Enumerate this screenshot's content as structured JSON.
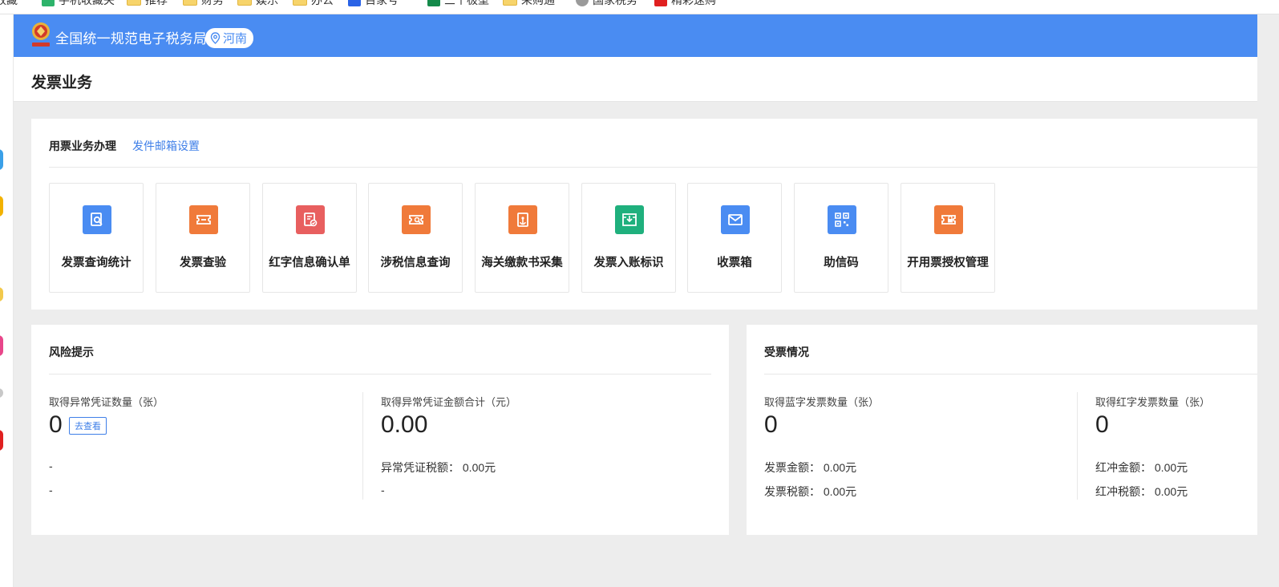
{
  "bookmarks": [
    {
      "label": "收藏",
      "icon": "none"
    },
    {
      "label": "手机收藏夹",
      "icon": "phone-bookmark-icon"
    },
    {
      "label": "推荐",
      "icon": "folder-icon"
    },
    {
      "label": "财务",
      "icon": "folder-icon"
    },
    {
      "label": "娱乐",
      "icon": "folder-icon"
    },
    {
      "label": "办公",
      "icon": "folder-icon"
    },
    {
      "label": "百家号",
      "icon": "baidu-icon"
    },
    {
      "label": "三个极型",
      "icon": "green-app-icon"
    },
    {
      "label": "采购通",
      "icon": "folder-icon"
    },
    {
      "label": "国家税务",
      "icon": "gear-icon"
    },
    {
      "label": "精彩速购",
      "icon": "red-app-icon"
    }
  ],
  "header": {
    "site_title": "全国统一规范电子税务局",
    "region": "河南",
    "accent": "#4a8cf2"
  },
  "page": {
    "title": "发票业务"
  },
  "ops": {
    "tab_active": "用票业务办理",
    "tab_link": "发件邮箱设置",
    "tiles": [
      {
        "label": "发票查询统计",
        "icon": "invoice-search-icon",
        "color": "#4a8cf2"
      },
      {
        "label": "发票查验",
        "icon": "ticket-check-icon",
        "color": "#f07a3a"
      },
      {
        "label": "红字信息确认单",
        "icon": "red-invoice-confirm-icon",
        "color": "#e85f5f"
      },
      {
        "label": "涉税信息查询",
        "icon": "tax-info-search-icon",
        "color": "#f07a3a"
      },
      {
        "label": "海关缴款书采集",
        "icon": "customs-payment-icon",
        "color": "#f07a3a"
      },
      {
        "label": "发票入账标识",
        "icon": "invoice-ledger-icon",
        "color": "#1fb07d"
      },
      {
        "label": "收票箱",
        "icon": "mail-icon",
        "color": "#4a8cf2"
      },
      {
        "label": "助信码",
        "icon": "qr-code-icon",
        "color": "#4a8cf2"
      },
      {
        "label": "开用票授权管理",
        "icon": "invoice-auth-icon",
        "color": "#f07a3a"
      }
    ]
  },
  "risk": {
    "title": "风险提示",
    "left": {
      "label": "取得异常凭证数量（张）",
      "value": "0",
      "button": "去查看",
      "line1": "-",
      "line2": "-"
    },
    "right": {
      "label": "取得异常凭证金额合计（元）",
      "value": "0.00",
      "line1": "异常凭证税额：  0.00元",
      "line2": "-"
    }
  },
  "receive": {
    "title": "受票情况",
    "left": {
      "label": "取得蓝字发票数量（张）",
      "value": "0",
      "line1": "发票金额：  0.00元",
      "line2": "发票税额：  0.00元"
    },
    "right": {
      "label": "取得红字发票数量（张）",
      "value": "0",
      "line1": "红冲金额：  0.00元",
      "line2": "红冲税额：  0.00元"
    }
  }
}
